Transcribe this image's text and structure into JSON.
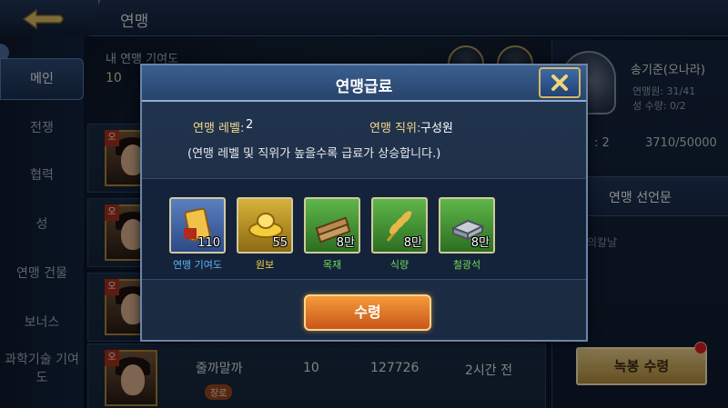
{
  "header": {
    "title": "연맹"
  },
  "sidebar": {
    "items": [
      {
        "label": "메인"
      },
      {
        "label": "전쟁"
      },
      {
        "label": "협력"
      },
      {
        "label": "성"
      },
      {
        "label": "연맹 건물"
      },
      {
        "label": "보너스"
      },
      {
        "label": "과학기술 기여도"
      }
    ]
  },
  "main": {
    "contribution_label": "내 연맹 기여도",
    "contribution_value": "10",
    "rows": [
      {
        "badge": "오",
        "name": "",
        "role": "",
        "level": "",
        "power": "",
        "time": ""
      },
      {
        "badge": "오",
        "name": "",
        "role": "",
        "level": "",
        "power": "",
        "time": ""
      },
      {
        "badge": "오",
        "name": "",
        "role": "",
        "level": "",
        "power": "",
        "time": ""
      },
      {
        "badge": "오",
        "name": "줄까말까",
        "role": "장로",
        "level": "10",
        "power": "127726",
        "time": "2시간 전"
      }
    ]
  },
  "right_panel": {
    "leader_name": "송기준(오나라)",
    "members": "연맹원: 31/41",
    "castles": "성 수량: 0/2",
    "stat_left": ": 2",
    "stat_right": "3710/50000",
    "declaration_title": "연맹 선언문",
    "declaration_text": "의칼날",
    "salary_button": "녹봉 수령"
  },
  "modal": {
    "title": "연맹급료",
    "level_label": "연맹 레벨:",
    "level_value": "2",
    "role_label": "연맹 직위:",
    "role_value": "구성원",
    "note": "(연맹 레벨 및 직위가 높을수록 급료가 상승합니다.)",
    "rewards": [
      {
        "name": "연맹 기여도",
        "qty": "110",
        "icon": "contribution-token-icon",
        "name_color": "#5fb6ff"
      },
      {
        "name": "원보",
        "qty": "55",
        "icon": "gold-ingot-icon",
        "name_color": "#f5d54a"
      },
      {
        "name": "목재",
        "qty": "8만",
        "icon": "wood-icon",
        "name_color": "#6fdc5a"
      },
      {
        "name": "식량",
        "qty": "8만",
        "icon": "wheat-icon",
        "name_color": "#6fdc5a"
      },
      {
        "name": "철광석",
        "qty": "8만",
        "icon": "iron-ore-icon",
        "name_color": "#6fdc5a"
      }
    ],
    "receive_button": "수령"
  }
}
